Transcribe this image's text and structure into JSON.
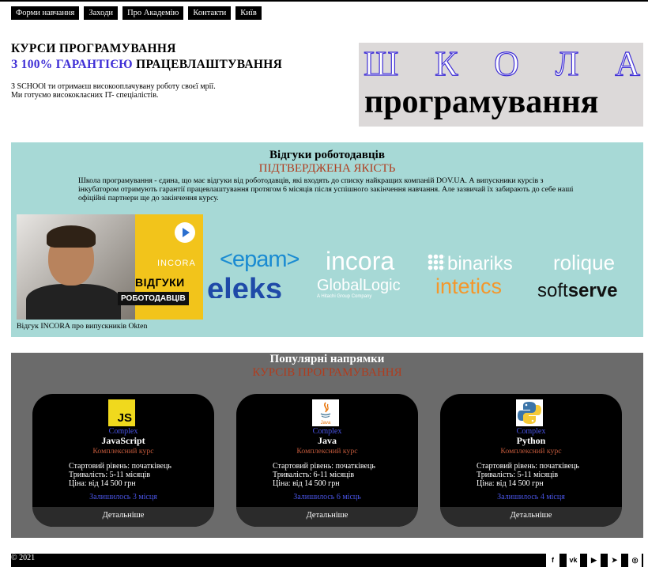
{
  "nav": {
    "items": [
      {
        "label": "Форми навчання"
      },
      {
        "label": "Заходи"
      },
      {
        "label": "Про Академію"
      },
      {
        "label": "Контакти"
      },
      {
        "label": "Київ"
      }
    ]
  },
  "hero": {
    "title_line1": "КУРСИ ПРОГРАМУВАННЯ",
    "title_accent": "З 100% ГАРАНТІЄЮ",
    "title_rest": " ПРАЦЕВЛАШТУВАННЯ",
    "desc_line1": "З SCHOOl ти отримаєш високооплачувану роботу своєї мрії.",
    "desc_line2": "Ми готуємо висококласних IT- спеціалістів.",
    "school_letters": [
      "Ш",
      "К",
      "О",
      "Л",
      "А"
    ],
    "programming": "програмування"
  },
  "reviews": {
    "title": "Відгуки роботодавців",
    "subtitle": "ПІДТВЕРДЖЕНА ЯКІСТЬ",
    "text": "Школа програмування - єдина, що має відгуки від роботодавців, які входять до списку найкращих компаній DOV.UA. А випускники курсів з інкубатором отримують гарантії працевлаштування протягом 6 місяців після успішного закінчення навчання. Але зазвичай їх забирають до себе наші офіційні партнери ще до закінчення курсу.",
    "video": {
      "brand": "INCORA",
      "caption_line1": "ВІДГУКИ",
      "caption_line2": "РОБОТОДАВЦІВ",
      "label": "Відгук INCORA про випускників Okten"
    },
    "logos": {
      "epam": "<epam>",
      "eleks": "eleks",
      "incora": "incora",
      "globallogic": "GlobalLogic",
      "globallogic_sub": "A Hitachi Group Company",
      "binariks": "binariks",
      "intetics": "intetics",
      "rolique": "rolique",
      "softserve_soft": "soft",
      "softserve_serve": "serve"
    }
  },
  "courses": {
    "title": "Популярні напрямки",
    "subtitle": "КУРСІВ ПРОГРАМУВАННЯ",
    "cards": [
      {
        "icon": "javascript-icon",
        "icon_text": "JS",
        "complex": "Complex",
        "name": "JavaScript",
        "type": "Комплексний курс",
        "level": "Стартовий рівень: початківець",
        "duration": "Тривалість: 5-11 місяців",
        "price": "Ціна: від 14 500 грн",
        "left": "Залишилось 3 місця",
        "button": "Детальніше"
      },
      {
        "icon": "java-icon",
        "icon_text": "Java",
        "complex": "Complex",
        "name": "Java",
        "type": "Комплексний курс",
        "level": "Стартовий рівень: початківець",
        "duration": "Тривалість: 6-11 місяців",
        "price": "Ціна: від 14 500 грн",
        "left": "Залишилось 6 місць",
        "button": "Детальніше"
      },
      {
        "icon": "python-icon",
        "icon_text": "",
        "complex": "Complex",
        "name": "Python",
        "type": "Комплексний курс",
        "level": "Стартовий рівень: початківець",
        "duration": "Тривалість: 5-11 місяців",
        "price": "Ціна: від 14 500 грн",
        "left": "Залишилось 4 місця",
        "button": "Детальніше"
      }
    ]
  },
  "footer": {
    "copyright": "© 2021",
    "socials": [
      {
        "icon": "facebook-icon",
        "glyph": "f"
      },
      {
        "icon": "vk-icon",
        "glyph": "vk"
      },
      {
        "icon": "youtube-icon",
        "glyph": "▶"
      },
      {
        "icon": "telegram-icon",
        "glyph": "➤"
      },
      {
        "icon": "instagram-icon",
        "glyph": "◎"
      }
    ]
  },
  "colors": {
    "accent_blue": "#3f2fd6",
    "accent_red": "#b03c1e",
    "reviews_bg": "#a7d9d6",
    "courses_bg": "#6b6b6b"
  }
}
